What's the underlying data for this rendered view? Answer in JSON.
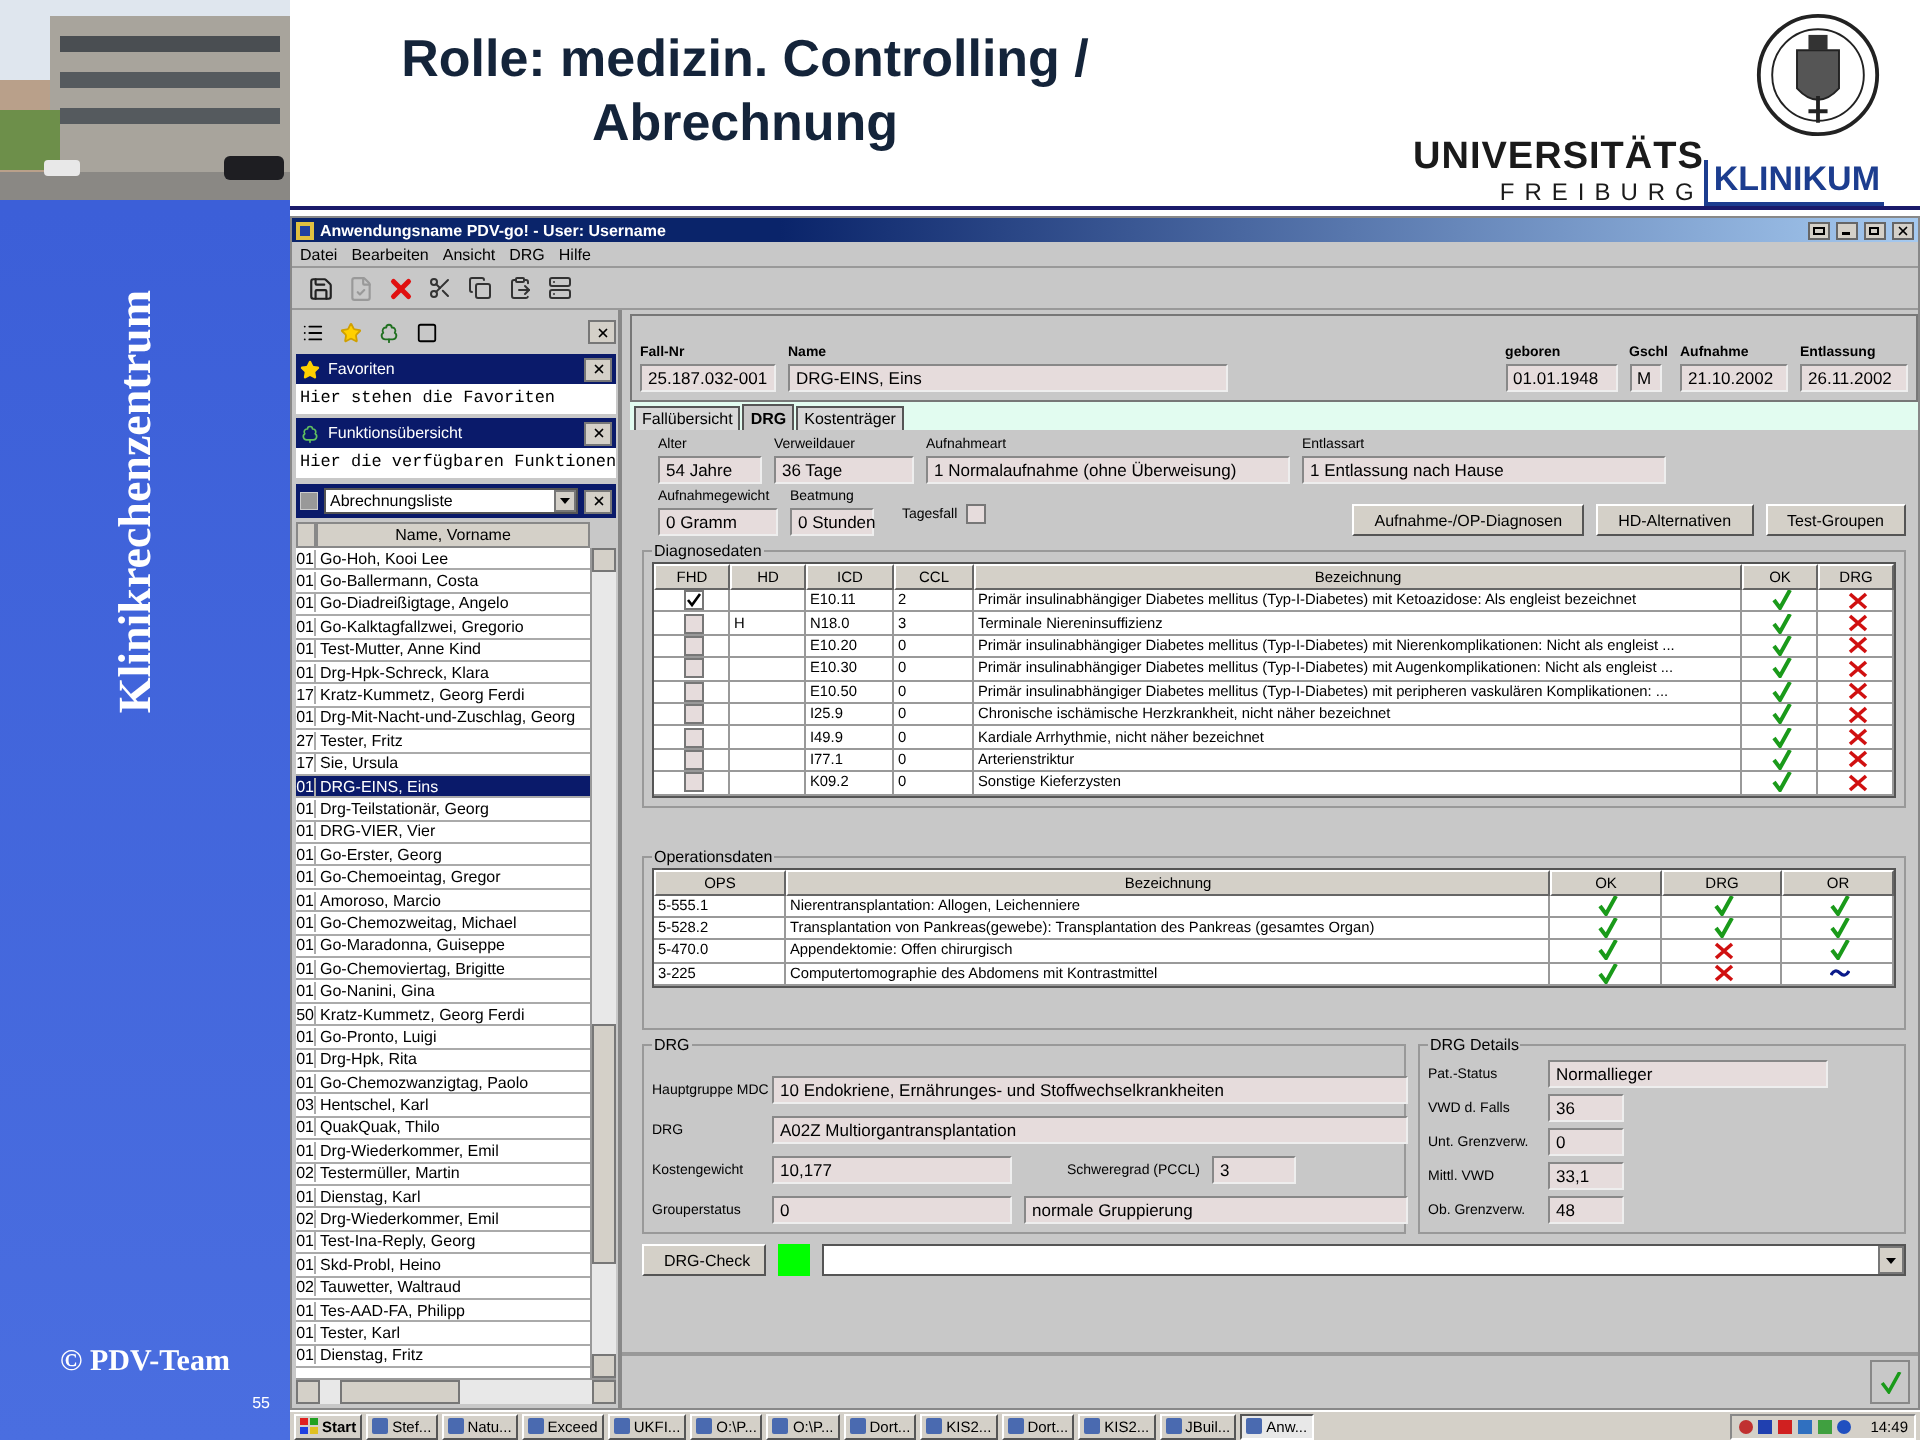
{
  "slide": {
    "title_lines": [
      "Rolle: medizin. Controlling /",
      "Abrechnung"
    ],
    "logo": {
      "line_1": "UNIVERSITÄTS",
      "line_2": "FREIBURG",
      "line_3": "KLINIKUM"
    },
    "side_label": "Klinikrechenzentrum",
    "footer": "© PDV-Team",
    "page_number": "55"
  },
  "window": {
    "title": "Anwendungsname PDV-go! - User: Username"
  },
  "menu": [
    "Datei",
    "Bearbeiten",
    "Ansicht",
    "DRG",
    "Hilfe"
  ],
  "left_pane": {
    "favorites": {
      "title": "Favoriten",
      "text": "Hier stehen die Favoriten"
    },
    "functions": {
      "title": "Funktionsübersicht",
      "text": "Hier die verfügbaren Funktionen"
    },
    "list_select": "Abrechnungsliste",
    "list_header": "Name, Vorname",
    "rows": [
      {
        "code": "01",
        "name": "Go-Hoh, Kooi Lee",
        "selected": false
      },
      {
        "code": "01",
        "name": "Go-Ballermann, Costa",
        "selected": false
      },
      {
        "code": "01",
        "name": "Go-Diadreißigtage, Angelo",
        "selected": false
      },
      {
        "code": "01",
        "name": "Go-Kalktagfallzwei, Gregorio",
        "selected": false
      },
      {
        "code": "01",
        "name": "Test-Mutter, Anne Kind",
        "selected": false
      },
      {
        "code": "01",
        "name": "Drg-Hpk-Schreck, Klara",
        "selected": false
      },
      {
        "code": "17",
        "name": "Kratz-Kummetz, Georg Ferdi",
        "selected": false
      },
      {
        "code": "01",
        "name": "Drg-Mit-Nacht-und-Zuschlag, Georg",
        "selected": false
      },
      {
        "code": "27",
        "name": "Tester, Fritz",
        "selected": false
      },
      {
        "code": "17",
        "name": "Sie, Ursula",
        "selected": false
      },
      {
        "code": "01",
        "name": "DRG-EINS, Eins",
        "selected": true
      },
      {
        "code": "01",
        "name": "Drg-Teilstationär, Georg",
        "selected": false
      },
      {
        "code": "01",
        "name": "DRG-VIER, Vier",
        "selected": false
      },
      {
        "code": "01",
        "name": "Go-Erster, Georg",
        "selected": false
      },
      {
        "code": "01",
        "name": "Go-Chemoeintag, Gregor",
        "selected": false
      },
      {
        "code": "01",
        "name": "Amoroso, Marcio",
        "selected": false
      },
      {
        "code": "01",
        "name": "Go-Chemozweitag, Michael",
        "selected": false
      },
      {
        "code": "01",
        "name": "Go-Maradonna, Guiseppe",
        "selected": false
      },
      {
        "code": "01",
        "name": "Go-Chemoviertag, Brigitte",
        "selected": false
      },
      {
        "code": "01",
        "name": "Go-Nanini, Gina",
        "selected": false
      },
      {
        "code": "50",
        "name": "Kratz-Kummetz, Georg Ferdi",
        "selected": false
      },
      {
        "code": "01",
        "name": "Go-Pronto, Luigi",
        "selected": false
      },
      {
        "code": "01",
        "name": "Drg-Hpk, Rita",
        "selected": false
      },
      {
        "code": "01",
        "name": "Go-Chemozwanzigtag, Paolo",
        "selected": false
      },
      {
        "code": "03",
        "name": "Hentschel, Karl",
        "selected": false
      },
      {
        "code": "01",
        "name": "QuakQuak, Thilo",
        "selected": false
      },
      {
        "code": "01",
        "name": "Drg-Wiederkommer, Emil",
        "selected": false
      },
      {
        "code": "02",
        "name": "Testermüller, Martin",
        "selected": false
      },
      {
        "code": "01",
        "name": "Dienstag, Karl",
        "selected": false
      },
      {
        "code": "02",
        "name": "Drg-Wiederkommer, Emil",
        "selected": false
      },
      {
        "code": "01",
        "name": "Test-Ina-Reply, Georg",
        "selected": false
      },
      {
        "code": "01",
        "name": "Skd-Probl, Heino",
        "selected": false
      },
      {
        "code": "02",
        "name": "Tauwetter, Waltraud",
        "selected": false
      },
      {
        "code": "01",
        "name": "Tes-AAD-FA, Philipp",
        "selected": false
      },
      {
        "code": "01",
        "name": "Tester, Karl",
        "selected": false
      },
      {
        "code": "01",
        "name": "Dienstag, Fritz",
        "selected": false
      }
    ]
  },
  "case_header": {
    "fields": [
      {
        "label": "Fall-Nr",
        "value": "25.187.032-001"
      },
      {
        "label": "Name",
        "value": "DRG-EINS, Eins"
      },
      {
        "label": "geboren",
        "value": "01.01.1948"
      },
      {
        "label": "Gschl",
        "value": "M"
      },
      {
        "label": "Aufnahme",
        "value": "21.10.2002"
      },
      {
        "label": "Entlassung",
        "value": "26.11.2002"
      }
    ]
  },
  "tabs": [
    {
      "label": "Fallübersicht",
      "selected": false
    },
    {
      "label": "DRG",
      "selected": true
    },
    {
      "label": "Kostenträger",
      "selected": false
    }
  ],
  "drg_tab": {
    "row_1": [
      {
        "label": "Alter",
        "value": "54 Jahre"
      },
      {
        "label": "Verweildauer",
        "value": "36 Tage"
      },
      {
        "label": "Aufnahmeart",
        "value": "1 Normalaufnahme (ohne Überweisung)"
      },
      {
        "label": "Entlassart",
        "value": "1 Entlassung nach Hause"
      }
    ],
    "row_2": [
      {
        "label": "Aufnahmegewicht",
        "value": "0 Gramm"
      },
      {
        "label": "Beatmung",
        "value": "0 Stunden"
      }
    ],
    "tagesfall": {
      "label": "Tagesfall",
      "checked": false
    },
    "buttons": [
      "Aufnahme-/OP-Diagnosen",
      "HD-Alternativen",
      "Test-Groupen"
    ]
  },
  "diagnoses": {
    "title": "Diagnosedaten",
    "columns": [
      "FHD",
      "HD",
      "ICD",
      "CCL",
      "Bezeichnung",
      "OK",
      "DRG"
    ],
    "rows": [
      {
        "fhd": true,
        "icd": "E10.11",
        "ccl": "2",
        "text": "Primär insulinabhängiger Diabetes mellitus (Typ-I-Diabetes) mit Ketoazidose: Als engleist bezeichnet",
        "ok": {
          "kind": "check"
        },
        "drg": {
          "kind": "cross"
        }
      },
      {
        "fhd": false,
        "hd": "H",
        "icd": "N18.0",
        "ccl": "3",
        "text": "Terminale Niereninsuffizienz",
        "ok": {
          "kind": "check"
        },
        "drg": {
          "kind": "cross"
        }
      },
      {
        "fhd": false,
        "icd": "E10.20",
        "ccl": "0",
        "text": "Primär insulinabhängiger Diabetes mellitus (Typ-I-Diabetes) mit Nierenkomplikationen: Nicht als engleist ...",
        "ok": {
          "kind": "check"
        },
        "drg": {
          "kind": "cross"
        }
      },
      {
        "fhd": false,
        "icd": "E10.30",
        "ccl": "0",
        "text": "Primär insulinabhängiger Diabetes mellitus (Typ-I-Diabetes) mit Augenkomplikationen: Nicht als engleist ...",
        "ok": {
          "kind": "check"
        },
        "drg": {
          "kind": "cross"
        }
      },
      {
        "fhd": false,
        "icd": "E10.50",
        "ccl": "0",
        "text": "Primär insulinabhängiger Diabetes mellitus (Typ-I-Diabetes) mit peripheren vaskulären Komplikationen: ...",
        "ok": {
          "kind": "check"
        },
        "drg": {
          "kind": "cross"
        }
      },
      {
        "fhd": false,
        "icd": "I25.9",
        "ccl": "0",
        "text": "Chronische ischämische Herzkrankheit, nicht näher bezeichnet",
        "ok": {
          "kind": "check"
        },
        "drg": {
          "kind": "cross"
        }
      },
      {
        "fhd": false,
        "icd": "I49.9",
        "ccl": "0",
        "text": "Kardiale Arrhythmie, nicht näher bezeichnet",
        "ok": {
          "kind": "check"
        },
        "drg": {
          "kind": "cross"
        }
      },
      {
        "fhd": false,
        "icd": "I77.1",
        "ccl": "0",
        "text": "Arterienstriktur",
        "ok": {
          "kind": "check"
        },
        "drg": {
          "kind": "cross"
        }
      },
      {
        "fhd": false,
        "icd": "K09.2",
        "ccl": "0",
        "text": "Sonstige Kieferzysten",
        "ok": {
          "kind": "check"
        },
        "drg": {
          "kind": "cross"
        }
      }
    ]
  },
  "operations": {
    "title": "Operationsdaten",
    "columns": [
      "OPS",
      "Bezeichnung",
      "OK",
      "DRG",
      "OR"
    ],
    "rows": [
      {
        "ops": "5-555.1",
        "text": "Nierentransplantation: Allogen, Leichenniere",
        "ok": {
          "kind": "check"
        },
        "drg": {
          "kind": "check"
        },
        "or": {
          "kind": "check"
        }
      },
      {
        "ops": "5-528.2",
        "text": "Transplantation von Pankreas(gewebe): Transplantation des Pankreas (gesamtes Organ)",
        "ok": {
          "kind": "check"
        },
        "drg": {
          "kind": "check"
        },
        "or": {
          "kind": "check"
        }
      },
      {
        "ops": "5-470.0",
        "text": "Appendektomie: Offen chirurgisch",
        "ok": {
          "kind": "check"
        },
        "drg": {
          "kind": "cross"
        },
        "or": {
          "kind": "check"
        }
      },
      {
        "ops": "3-225",
        "text": "Computertomographie des Abdomens mit Kontrastmittel",
        "ok": {
          "kind": "check"
        },
        "drg": {
          "kind": "cross"
        },
        "or": {
          "kind": "tilde"
        }
      }
    ]
  },
  "drg": {
    "title": "DRG",
    "mdc": {
      "label": "Hauptgruppe MDC",
      "value": "10   Endokriene, Ernährunges- und Stoffwechselkrankheiten"
    },
    "drg": {
      "label": "DRG",
      "value": "A02Z  Multiorgantransplantation"
    },
    "weight": {
      "label": "Kostengewicht",
      "value": "10,177"
    },
    "pccl": {
      "label": "Schweregrad (PCCL)",
      "value": "3"
    },
    "grouper": {
      "label": "Grouperstatus",
      "value": "0",
      "text": "normale Gruppierung"
    }
  },
  "drg_details": {
    "title": "DRG Details",
    "fields": [
      {
        "label": "Pat.-Status",
        "value": "Normallieger"
      },
      {
        "label": "VWD d. Falls",
        "value": "36"
      },
      {
        "label": "Unt. Grenzverw.",
        "value": "0"
      },
      {
        "label": "Mittl. VWD",
        "value": "33,1"
      },
      {
        "label": "Ob. Grenzverw.",
        "value": "48"
      }
    ]
  },
  "drg_check": {
    "button": "DRG-Check",
    "passed": true
  },
  "taskbar": {
    "start": "Start",
    "items": [
      {
        "label": "Stef...",
        "selected": false
      },
      {
        "label": "Natu...",
        "selected": false
      },
      {
        "label": "Exceed",
        "selected": false
      },
      {
        "label": "UKFI...",
        "selected": false
      },
      {
        "label": "O:\\P...",
        "selected": false
      },
      {
        "label": "O:\\P...",
        "selected": false
      },
      {
        "label": "Dort...",
        "selected": false
      },
      {
        "label": "KIS2...",
        "selected": false
      },
      {
        "label": "Dort...",
        "selected": false
      },
      {
        "label": "KIS2...",
        "selected": false
      },
      {
        "label": "JBuil...",
        "selected": false
      },
      {
        "label": "Anw...",
        "selected": true
      }
    ],
    "clock": "14:49"
  }
}
